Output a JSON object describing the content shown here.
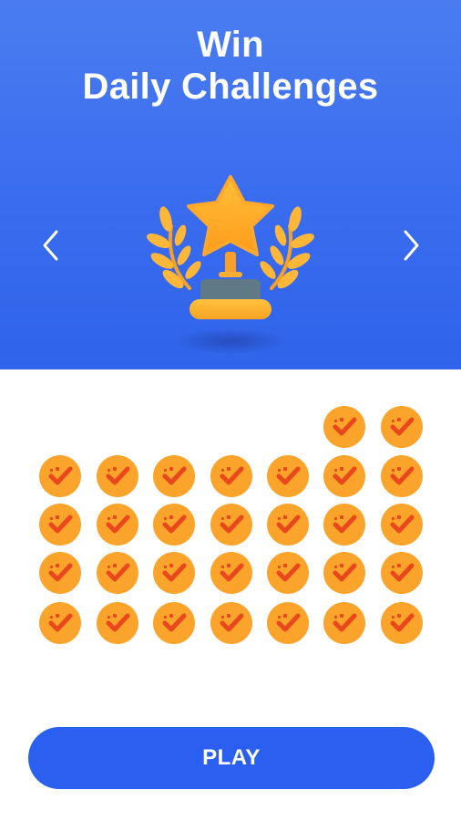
{
  "header": {
    "title_line1": "Win",
    "title_line2": "Daily Challenges",
    "prev_icon": "chevron-left-icon",
    "next_icon": "chevron-right-icon",
    "trophy_icon": "star-trophy-icon"
  },
  "calendar": {
    "completed_icon": "check-badge-icon",
    "completed_days": 30,
    "leading_empty_cells": 5
  },
  "actions": {
    "play_label": "PLAY"
  },
  "colors": {
    "hero_background": "#3a6cef",
    "day_completed": "#fba42c",
    "check_mark": "#e8481c",
    "play_button": "#2a5ff0"
  }
}
